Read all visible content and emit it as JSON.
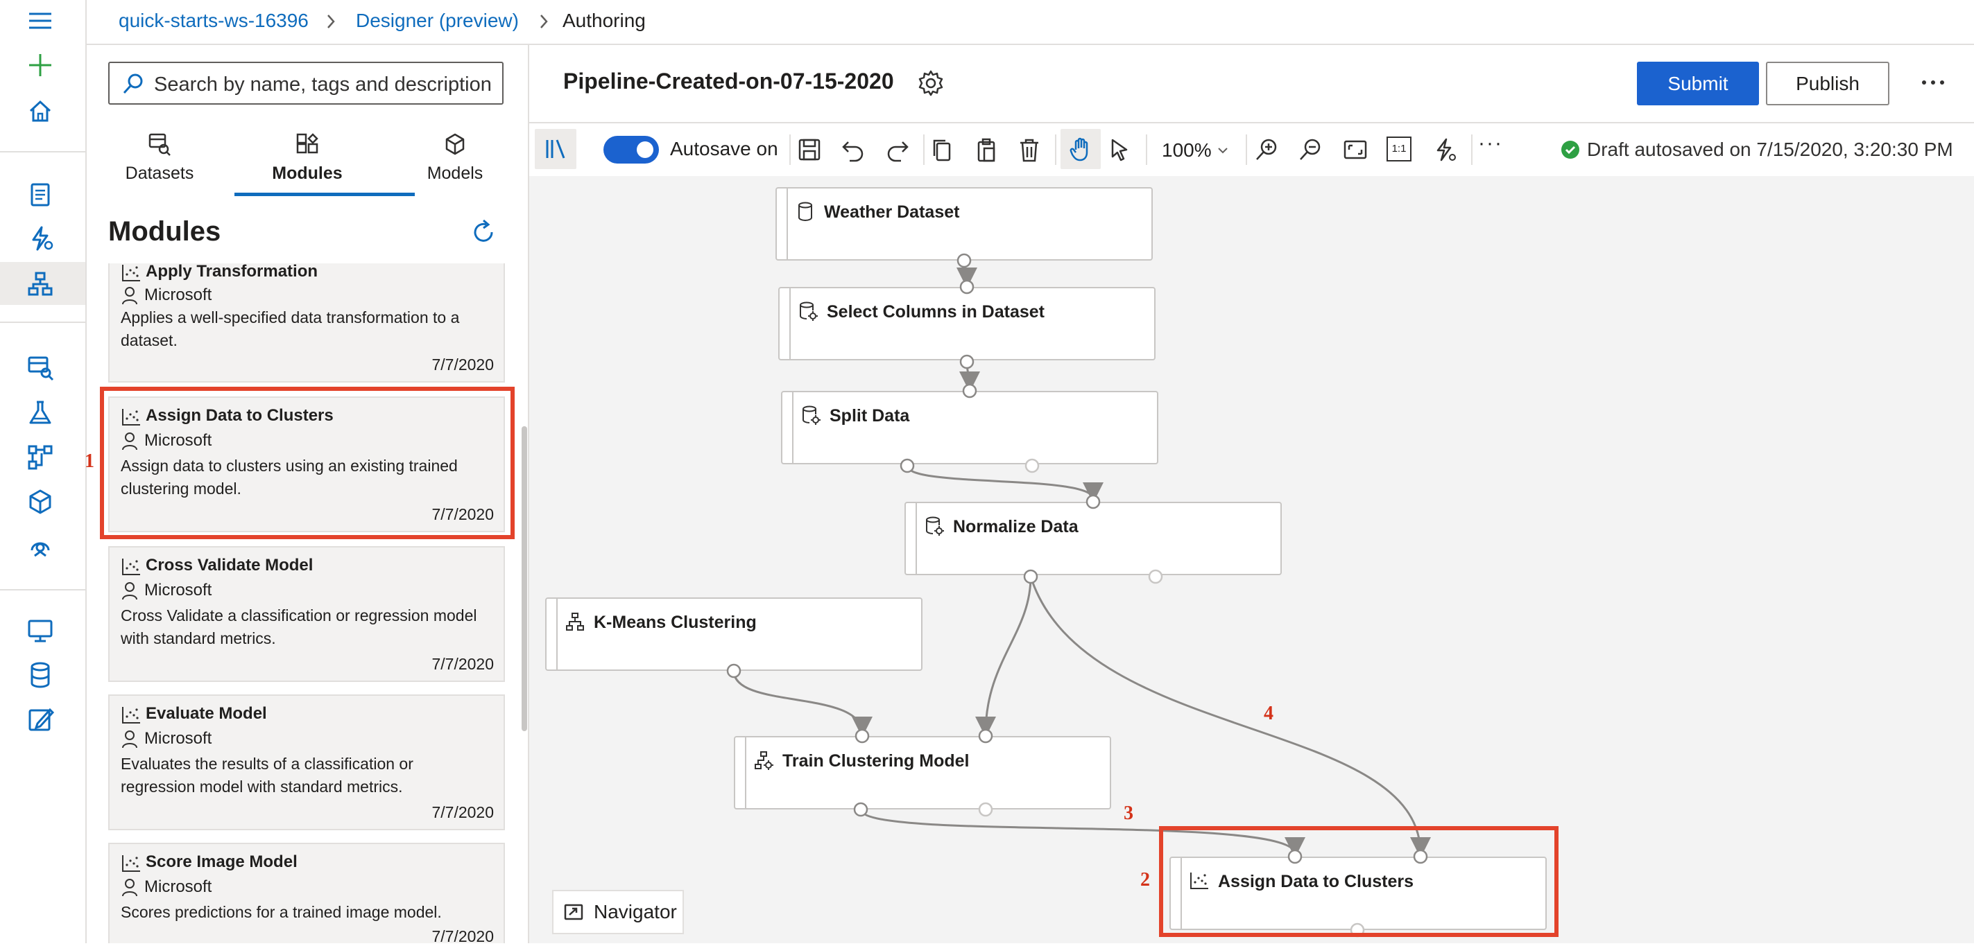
{
  "breadcrumb": {
    "workspace": "quick-starts-ws-16396",
    "designer": "Designer (preview)",
    "current": "Authoring"
  },
  "search": {
    "placeholder": "Search by name, tags and description"
  },
  "tabs": [
    {
      "label": "Datasets",
      "icon": "datasets-icon"
    },
    {
      "label": "Modules",
      "icon": "modules-icon",
      "selected": true
    },
    {
      "label": "Models",
      "icon": "models-icon"
    }
  ],
  "modules": {
    "title": "Modules",
    "items": [
      {
        "title": "Apply Transformation",
        "publisher": "Microsoft",
        "description": "Applies a well-specified data transformation to a dataset.",
        "date": "7/7/2020"
      },
      {
        "title": "Assign Data to Clusters",
        "publisher": "Microsoft",
        "description": "Assign data to clusters using an existing trained clustering model.",
        "date": "7/7/2020"
      },
      {
        "title": "Cross Validate Model",
        "publisher": "Microsoft",
        "description": "Cross Validate a classification or regression model with standard metrics.",
        "date": "7/7/2020"
      },
      {
        "title": "Evaluate Model",
        "publisher": "Microsoft",
        "description": "Evaluates the results of a classification or regression model with standard metrics.",
        "date": "7/7/2020"
      },
      {
        "title": "Score Image Model",
        "publisher": "Microsoft",
        "description": "Scores predictions for a trained image model.",
        "date": "7/7/2020"
      }
    ]
  },
  "pipeline": {
    "title": "Pipeline-Created-on-07-15-2020"
  },
  "actions": {
    "submit": "Submit",
    "publish": "Publish",
    "more": "···"
  },
  "toolbar": {
    "autosave_label": "Autosave on",
    "autosave_on": true,
    "zoom": "100%",
    "fit_label": "1:1",
    "more": "···",
    "draft_status": "Draft autosaved on 7/15/2020, 3:20:30 PM"
  },
  "nodes": [
    {
      "id": "weather",
      "label": "Weather Dataset",
      "icon": "dataset-icon"
    },
    {
      "id": "select",
      "label": "Select Columns in Dataset",
      "icon": "data-transform-icon"
    },
    {
      "id": "split",
      "label": "Split Data",
      "icon": "data-transform-icon"
    },
    {
      "id": "normalize",
      "label": "Normalize Data",
      "icon": "data-transform-icon"
    },
    {
      "id": "kmeans",
      "label": "K-Means Clustering",
      "icon": "hierarchy-icon"
    },
    {
      "id": "train",
      "label": "Train Clustering Model",
      "icon": "train-icon"
    },
    {
      "id": "assign",
      "label": "Assign Data to Clusters",
      "icon": "scatter-icon"
    }
  ],
  "navigator": {
    "label": "Navigator"
  },
  "annotations": [
    "1",
    "2",
    "3",
    "4"
  ],
  "colors": {
    "accent": "#1b62cf",
    "link": "#0f6cbd",
    "highlight": "#e3432b",
    "success": "#2ea043"
  }
}
